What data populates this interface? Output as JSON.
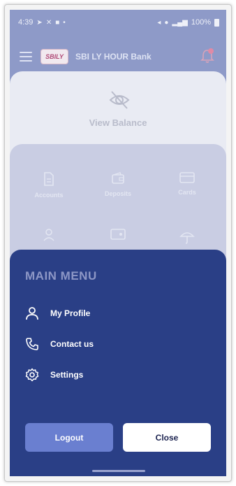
{
  "status_bar": {
    "time": "4:39",
    "battery": "100%"
  },
  "app_bar": {
    "logo_text": "SBILY",
    "bank_name": "SBI LY HOUR Bank"
  },
  "balance": {
    "label": "View Balance"
  },
  "services": {
    "items": [
      {
        "label": "Accounts",
        "icon": "document-icon"
      },
      {
        "label": "Deposits",
        "icon": "wallet-icon"
      },
      {
        "label": "Cards",
        "icon": "card-icon"
      },
      {
        "label": "",
        "icon": "transfer-icon"
      },
      {
        "label": "",
        "icon": "payment-icon"
      },
      {
        "label": "",
        "icon": "umbrella-icon"
      }
    ]
  },
  "main_menu": {
    "title": "MAIN MENU",
    "items": [
      {
        "label": "My Profile",
        "icon": "user-icon"
      },
      {
        "label": "Contact us",
        "icon": "phone-icon"
      },
      {
        "label": "Settings",
        "icon": "gear-icon"
      }
    ],
    "logout_label": "Logout",
    "close_label": "Close"
  },
  "colors": {
    "sheet": "#2a3f86",
    "title": "#8d97c6",
    "logout": "#6a7fd0",
    "close": "#ffffff"
  }
}
